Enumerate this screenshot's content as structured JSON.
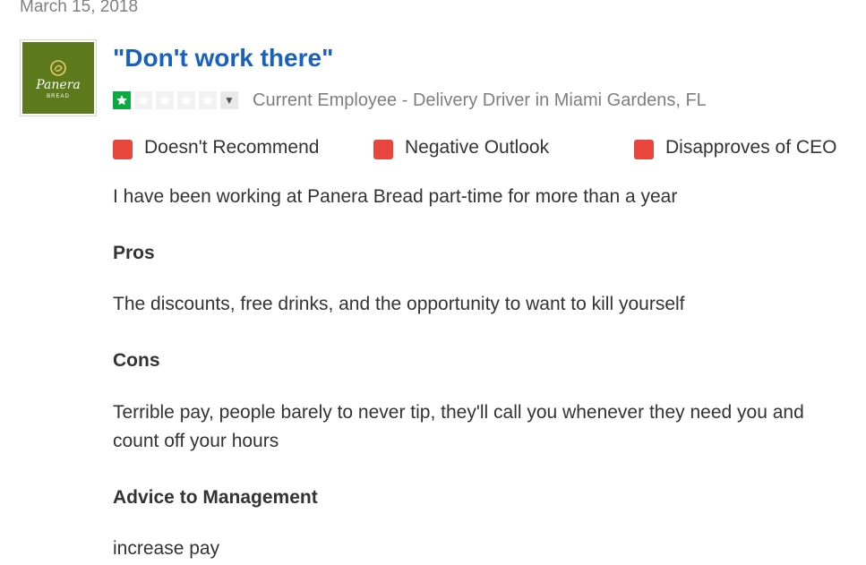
{
  "review": {
    "date": "March 15, 2018",
    "logo": {
      "brand": "Panera",
      "sub": "BREAD"
    },
    "title": "\"Don't work there\"",
    "rating": {
      "value": 1,
      "max": 5
    },
    "role": "Current Employee - Delivery Driver in Miami Gardens, FL",
    "flags": [
      {
        "label": "Doesn't Recommend",
        "color": "#e8453c"
      },
      {
        "label": "Negative Outlook",
        "color": "#e8453c"
      },
      {
        "label": "Disapproves of CEO",
        "color": "#e8453c"
      }
    ],
    "summary": "I have been working at Panera Bread part-time for more than a year",
    "pros_heading": "Pros",
    "pros": "The discounts, free drinks, and the opportunity to want to kill yourself",
    "cons_heading": "Cons",
    "cons": "Terrible pay, people barely to never tip, they'll call you whenever they need you and count off your hours",
    "advice_heading": "Advice to Management",
    "advice": "increase pay"
  },
  "colors": {
    "title": "#1861bf",
    "star_filled": "#0caa41",
    "star_empty": "#f2f2f2",
    "flag": "#e8453c",
    "logo_bg": "#5c7a1c"
  },
  "icons": {
    "star": "star-icon",
    "dropdown": "chevron-down-icon",
    "flag": "red-square-icon"
  }
}
